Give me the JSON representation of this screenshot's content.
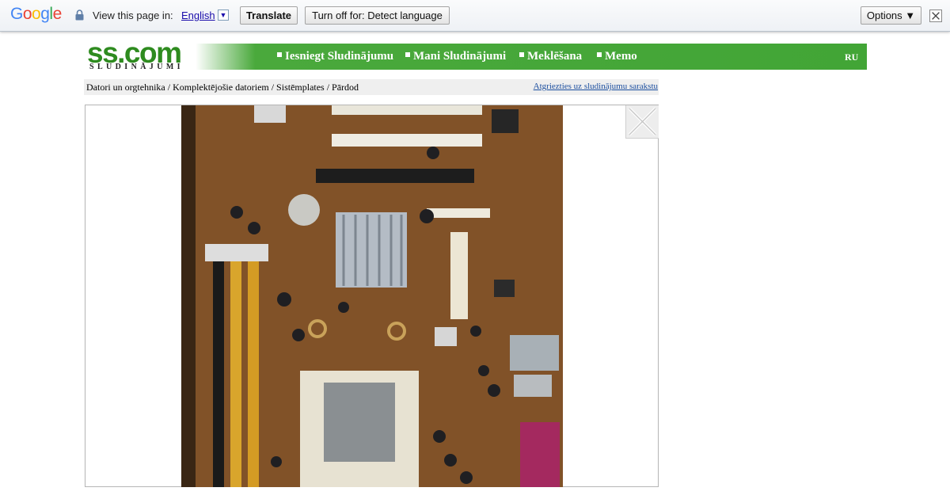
{
  "translate_bar": {
    "logo_letters": [
      "G",
      "o",
      "o",
      "g",
      "l",
      "e"
    ],
    "logo_colors": [
      "#4285f4",
      "#ea4335",
      "#fbbc05",
      "#4285f4",
      "#34a853",
      "#ea4335"
    ],
    "view_text": "View this page in:",
    "language": "English",
    "dropdown_arrow": "▼",
    "translate_label": "Translate",
    "turn_off_label": "Turn off for: Detect language",
    "options_label": "Options ▼",
    "close_icon": "close-icon"
  },
  "header": {
    "logo_text": "ss.com",
    "logo_sub": "SLUDINĀJUMI",
    "nav": [
      "Iesniegt Sludinājumu",
      "Mani Sludinājumi",
      "Meklēšana",
      "Memo"
    ],
    "lang": "RU",
    "colors": {
      "bar_green": "#42a536",
      "logo_green": "#2e8b1f"
    }
  },
  "breadcrumb": {
    "path": "Datori un orgtehnika / Komplektējošie datoriem / Sistēmplates / Pārdod",
    "back_link": "Atgriezties uz sludinājumu sarakstu"
  },
  "viewer": {
    "image_desc": "motherboard photo",
    "close_icon": "close-icon"
  }
}
